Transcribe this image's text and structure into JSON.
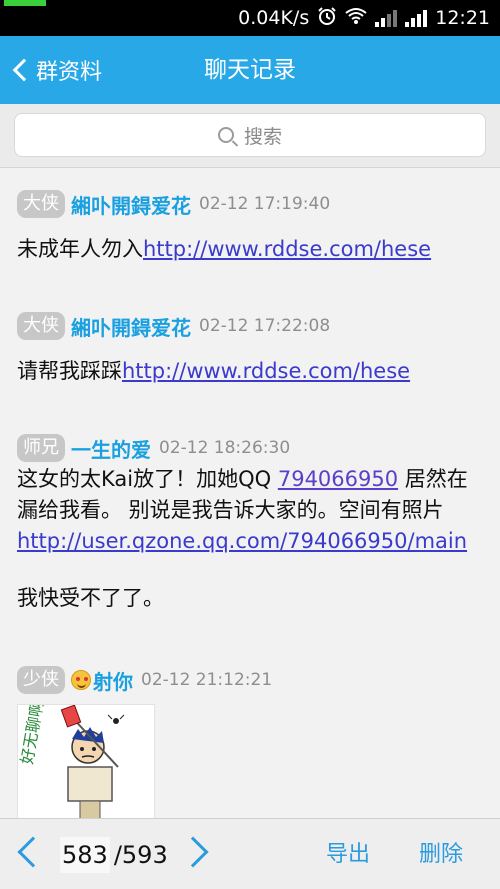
{
  "status_bar": {
    "net_speed": "0.04K/s",
    "time": "12:21"
  },
  "header": {
    "back_label": "群资料",
    "title": "聊天记录"
  },
  "search": {
    "placeholder": "搜索"
  },
  "messages": [
    {
      "rank": "大侠",
      "nick": "緗卟開鍀爱花",
      "time": "02-12 17:19:40",
      "text_before": "未成年人勿入",
      "link": "http://www.rddse.com/hese"
    },
    {
      "rank": "大侠",
      "nick": "緗卟開鍀爱花",
      "time": "02-12 17:22:08",
      "text_before": "请帮我踩踩",
      "link": "http://www.rddse.com/hese"
    },
    {
      "rank": "师兄",
      "nick": "一生的爱",
      "time": "02-12 18:26:30",
      "text_a": "这女的太Kai放了！加她QQ ",
      "qq": "794066950",
      "text_b": " 居然在漏给我看。 别说是我告诉大家的。空间有照片",
      "link": "http://user.qzone.qq.com/794066950/main",
      "text_after": " 我快受不了了。"
    },
    {
      "rank": "少侠",
      "nick": "射你",
      "time": "02-12 21:12:21",
      "sticker_text": "好无聊啊"
    }
  ],
  "bottom_bar": {
    "current_page": "583",
    "total_pages": "/593",
    "export_label": "导出",
    "delete_label": "删除"
  },
  "colors": {
    "accent": "#29a8e7",
    "nick": "#1aa0e0",
    "link": "#3a3acd"
  }
}
